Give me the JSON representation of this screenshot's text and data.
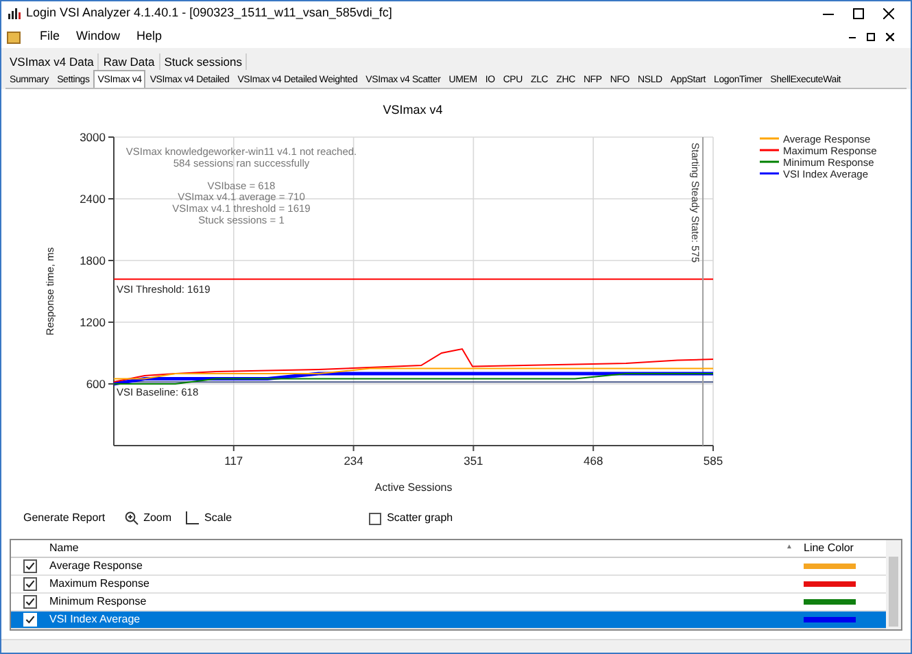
{
  "window": {
    "title": "Login VSI Analyzer 4.1.40.1 - [090323_1511_w11_vsan_585vdi_fc]"
  },
  "menu": [
    "File",
    "Window",
    "Help"
  ],
  "tabs_top": [
    {
      "label": "VSImax v4 Data",
      "selected": false
    },
    {
      "label": "Raw Data",
      "selected": false
    },
    {
      "label": "Stuck sessions",
      "selected": false
    }
  ],
  "tabs": [
    {
      "label": "Summary",
      "selected": false
    },
    {
      "label": "Settings",
      "selected": false
    },
    {
      "label": "VSImax v4",
      "selected": true
    },
    {
      "label": "VSImax v4 Detailed",
      "selected": false
    },
    {
      "label": "VSImax v4 Detailed Weighted",
      "selected": false
    },
    {
      "label": "VSImax v4 Scatter",
      "selected": false
    },
    {
      "label": "UMEM",
      "selected": false
    },
    {
      "label": "IO",
      "selected": false
    },
    {
      "label": "CPU",
      "selected": false
    },
    {
      "label": "ZLC",
      "selected": false
    },
    {
      "label": "ZHC",
      "selected": false
    },
    {
      "label": "NFP",
      "selected": false
    },
    {
      "label": "NFO",
      "selected": false
    },
    {
      "label": "NSLD",
      "selected": false
    },
    {
      "label": "AppStart",
      "selected": false
    },
    {
      "label": "LogonTimer",
      "selected": false
    },
    {
      "label": "ShellExecuteWait",
      "selected": false
    }
  ],
  "chart": {
    "info_lines": [
      "VSImax knowledgeworker-win11 v4.1 not reached.",
      "584 sessions ran successfully",
      "VSIbase = 618",
      "VSImax v4.1 average = 710",
      "VSImax v4.1 threshold = 1619",
      "Stuck sessions = 1"
    ],
    "chart_data": {
      "type": "line",
      "title": "VSImax v4",
      "xlabel": "Active Sessions",
      "ylabel": "Response time, ms",
      "x": [
        0,
        30,
        60,
        100,
        150,
        200,
        250,
        300,
        320,
        340,
        350,
        400,
        450,
        500,
        550,
        585
      ],
      "series": [
        {
          "name": "Average Response",
          "color": "#ffa500",
          "values": [
            650,
            650,
            700,
            700,
            700,
            700,
            750,
            750,
            750,
            750,
            750,
            750,
            750,
            750,
            750,
            750
          ]
        },
        {
          "name": "Maximum Response",
          "color": "#ff0000",
          "values": [
            620,
            680,
            700,
            720,
            730,
            740,
            760,
            780,
            900,
            940,
            770,
            780,
            790,
            800,
            830,
            840
          ]
        },
        {
          "name": "Minimum Response",
          "color": "#008000",
          "values": [
            600,
            600,
            600,
            650,
            650,
            650,
            650,
            650,
            650,
            650,
            650,
            650,
            650,
            700,
            700,
            700
          ]
        },
        {
          "name": "VSI Index Average",
          "color": "#0000ff",
          "values": [
            600,
            650,
            650,
            650,
            650,
            700,
            700,
            700,
            700,
            700,
            700,
            700,
            700,
            700,
            700,
            700
          ]
        }
      ],
      "grid": true,
      "legend": true,
      "xlim": [
        0,
        585
      ],
      "ylim": [
        0,
        3000
      ],
      "xticks": [
        117,
        234,
        351,
        468,
        585
      ],
      "yticks": [
        600,
        1200,
        1800,
        2400,
        3000
      ],
      "ref_lines": [
        {
          "axis": "y",
          "value": 1619,
          "label": "VSI Threshold: 1619",
          "color": "#ff0000"
        },
        {
          "axis": "y",
          "value": 618,
          "label": "VSI Baseline: 618",
          "color": "#4a5a8a"
        },
        {
          "axis": "x",
          "value": 575,
          "label": "Starting Steady State: 575",
          "color": "#a0a0a0"
        }
      ]
    }
  },
  "toolbar": [
    {
      "kind": "button",
      "label": "Generate Report"
    },
    {
      "kind": "zoom",
      "label": "Zoom"
    },
    {
      "kind": "scale",
      "label": "Scale"
    },
    {
      "kind": "checkbox",
      "label": "Scatter graph",
      "checked": false
    }
  ],
  "series_list": {
    "columns": [
      "Name",
      "Line Color"
    ],
    "sort_indicator": "▲",
    "rows": [
      {
        "name": "Average Response",
        "checked": true,
        "color": "#f5a623",
        "selected": false
      },
      {
        "name": "Maximum Response",
        "checked": true,
        "color": "#e81010",
        "selected": false
      },
      {
        "name": "Minimum Response",
        "checked": true,
        "color": "#108010",
        "selected": false
      },
      {
        "name": "VSI Index Average",
        "checked": true,
        "color": "#0000ee",
        "selected": true
      }
    ]
  }
}
